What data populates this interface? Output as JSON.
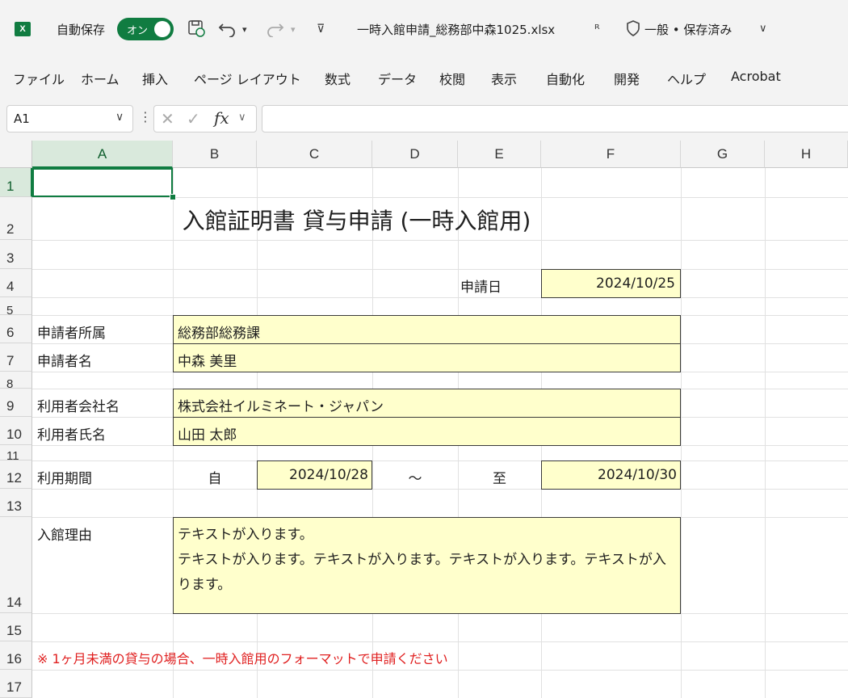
{
  "titlebar": {
    "app_icon": "X",
    "autosave_label": "自動保存",
    "autosave_toggle": "オン",
    "doc_title": "一時入館申請_総務部中森1025.xlsx",
    "sensitivity": "一般 • 保存済み",
    "icons": [
      "excel-icon",
      "save-icon",
      "undo-icon",
      "redo-icon",
      "customize-icon",
      "share-icon",
      "shield-icon",
      "chevron-down-icon"
    ]
  },
  "menu": [
    "ファイル",
    "ホーム",
    "挿入",
    "ページ レイアウト",
    "数式",
    "データ",
    "校閲",
    "表示",
    "自動化",
    "開発",
    "ヘルプ",
    "Acrobat"
  ],
  "formula_bar": {
    "name_box": "A1",
    "fx": "fx",
    "formula": ""
  },
  "columns": [
    "A",
    "B",
    "C",
    "D",
    "E",
    "F",
    "G",
    "H"
  ],
  "rows": [
    "1",
    "2",
    "3",
    "4",
    "5",
    "6",
    "7",
    "8",
    "9",
    "10",
    "11",
    "12",
    "13",
    "14",
    "15",
    "16",
    "17"
  ],
  "sheet": {
    "title": "入館証明書 貸与申請 (一時入館用)",
    "apply_date_label": "申請日",
    "apply_date": "2024/10/25",
    "dept_label": "申請者所属",
    "dept": "総務部総務課",
    "applicant_label": "申請者名",
    "applicant": "中森 美里",
    "company_label": "利用者会社名",
    "company": "株式会社イルミネート・ジャパン",
    "user_label": "利用者氏名",
    "user": "山田 太郎",
    "period_label": "利用期間",
    "from_label": "自",
    "from_date": "2024/10/28",
    "tilde": "～",
    "to_label": "至",
    "to_date": "2024/10/30",
    "reason_label": "入館理由",
    "reason_line1": "テキストが入ります。",
    "reason_line2": "テキストが入ります。テキストが入ります。テキストが入ります。テキストが入",
    "reason_line3": "ります。",
    "note": "※ 1ヶ月未満の貸与の場合、一時入館用のフォーマットで申請ください",
    "note_color": "#e02020",
    "input_fill": "#ffffcc"
  }
}
